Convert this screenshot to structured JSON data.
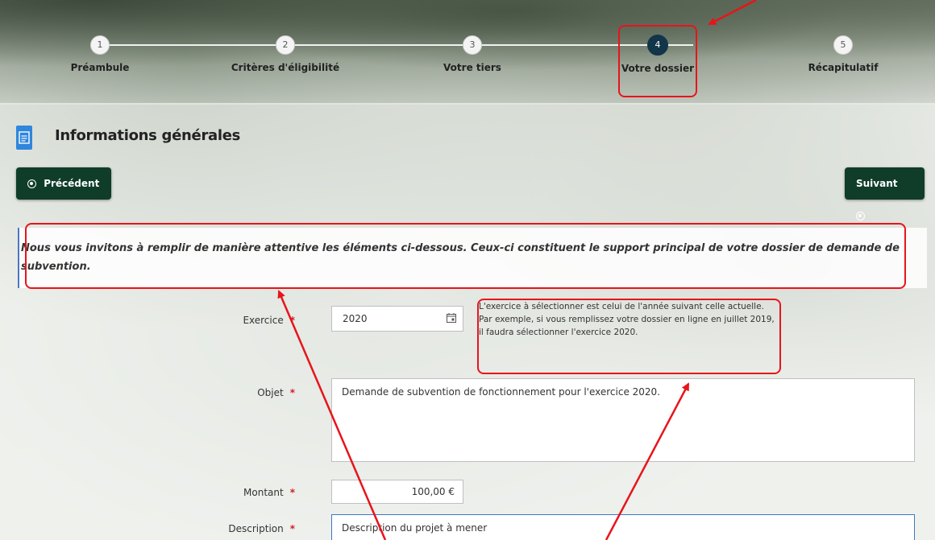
{
  "stepper": {
    "steps": [
      {
        "number": "1",
        "label": "Préambule"
      },
      {
        "number": "2",
        "label": "Critères d'éligibilité"
      },
      {
        "number": "3",
        "label": "Votre tiers"
      },
      {
        "number": "4",
        "label": "Votre dossier"
      },
      {
        "number": "5",
        "label": "Récapitulatif"
      }
    ],
    "active_step": 4
  },
  "section": {
    "title": "Informations générales"
  },
  "nav": {
    "previous_label": "Précédent",
    "next_label": "Suivant"
  },
  "intro": {
    "text": "Nous vous invitons à remplir de manière attentive les éléments ci-dessous. Ceux-ci constituent le support principal de votre dossier de demande de subvention."
  },
  "form": {
    "required_mark": "*",
    "exercice": {
      "label": "Exercice",
      "value": "2020"
    },
    "exercice_hint": "L'exercice à sélectionner est celui de l'année suivant celle actuelle. Par exemple, si vous remplissez votre dossier en ligne en juillet 2019, il faudra sélectionner l'exercice 2020.",
    "objet": {
      "label": "Objet",
      "value": "Demande de subvention de fonctionnement pour l'exercice 2020."
    },
    "montant": {
      "label": "Montant",
      "value": "100,00 €"
    },
    "description": {
      "label": "Description",
      "value": "Description du projet à mener"
    }
  },
  "colors": {
    "primary_button": "#0f3d2a",
    "active_step": "#13354a",
    "annotation": "#e8141b",
    "required": "#d0202a"
  },
  "icons": {
    "section": "document-icon",
    "previous": "circle-arrow-icon",
    "next": "circle-arrow-icon",
    "calendar": "calendar-icon"
  }
}
